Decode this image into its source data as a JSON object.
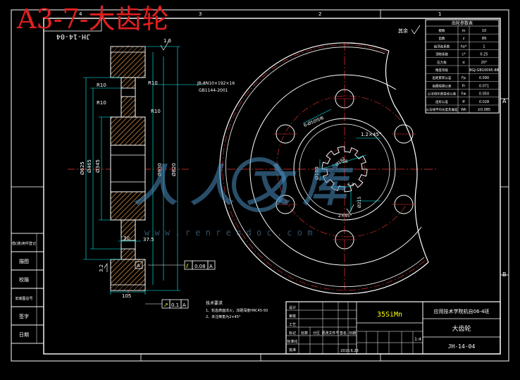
{
  "title": "A3-7-大齿轮",
  "drawing_code_mirrored": "JH-14-04",
  "watermark": {
    "cn": "人人文库",
    "url": "w w w . r e n r e n d o c . c o m"
  },
  "roughness_top": "1.6",
  "roughness_corner": "6.3",
  "roughness_corner_label": "其余",
  "roughness_keyway": "6.3",
  "roughness_bore": "1.6",
  "roughness_left": "3.2",
  "section_dims": {
    "r10_a": "R10",
    "r10_b": "R10",
    "r10_c": "R10",
    "r10_d": "R10",
    "r10_e": "R10",
    "d625": "Ø625",
    "d465": "Ø465",
    "d345": "Ø345",
    "d930": "Ø930",
    "d820": "Ø820",
    "w30": "30",
    "w375": "37.5",
    "w105": "105"
  },
  "spline_callout": "JB-8N10×192×16",
  "spline_callout_std": "GB1144-2001",
  "tol1_sym": "⫽",
  "tol1_val": "0.08",
  "tol1_ref": "A",
  "tol2_sym": "↗",
  "tol2_val": "0.1",
  "tol2_ref": "A",
  "datum_a": "A",
  "front_dims": {
    "holes": "6-Ø50均布",
    "chamfer": "1.2×45°",
    "spline": "Ø160",
    "spline2": "Ø192",
    "key_w": "16",
    "key_d": "6.3",
    "chamfer2": "2×45°",
    "key_h": "Ø215"
  },
  "tech_notes": [
    "技术要求",
    "1、轮齿表面淬火，淬硬深度HRC45-50",
    "2、未注倒角为2×45°"
  ],
  "param_table": {
    "header": "齿轮参数表",
    "rows": [
      [
        "模数",
        "m",
        "10"
      ],
      [
        "齿数",
        "z",
        "89"
      ],
      [
        "齿顶高系数",
        "ha*",
        "1"
      ],
      [
        "顶隙系数",
        "c*",
        "0.25"
      ],
      [
        "压力角",
        "α",
        "20°"
      ],
      [
        "精度等级",
        "",
        "8GJ-GB10095-88"
      ],
      [
        "齿距累积公差",
        "Fp",
        "0.090"
      ],
      [
        "齿圈径跳公差",
        "Fr",
        "0.071"
      ],
      [
        "公法线长度变动公差",
        "Fw",
        "0.050"
      ],
      [
        "齿形公差",
        "ff",
        "0.028"
      ],
      [
        "公法线平均长度及偏差",
        "Wk",
        "±0.085"
      ]
    ]
  },
  "left_column": [
    "借(通)用件登记",
    "描图",
    "校描",
    "旧底图总号",
    "签字",
    "日期"
  ],
  "title_block": {
    "material": "35SiMn",
    "company": "应用技术学院机自06-4班",
    "part": "大齿轮",
    "code": "JH-14-04",
    "scale": "1:4",
    "date": "2010.6.28",
    "h_labels": [
      "标记",
      "处数",
      "分区",
      "更改文件号",
      "签名",
      "日期"
    ],
    "r_labels": [
      "设计",
      "审核",
      "工艺",
      "标准化",
      "批准"
    ]
  },
  "frame_letters": {
    "a": "A",
    "b": "B"
  },
  "frame_numbers": [
    "1",
    "2",
    "3",
    "4"
  ]
}
